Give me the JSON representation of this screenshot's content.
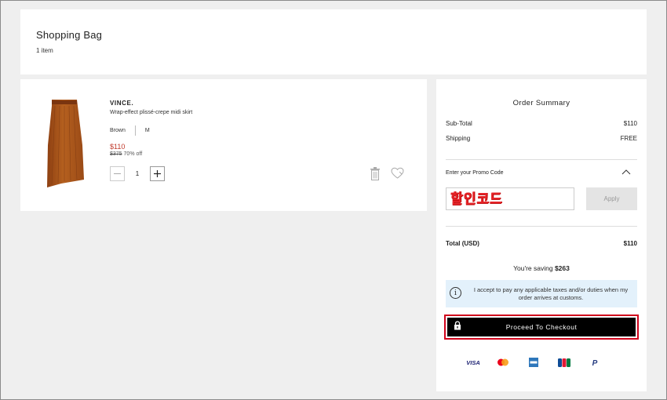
{
  "header": {
    "title": "Shopping Bag",
    "count": "1 item"
  },
  "item": {
    "brand": "VINCE.",
    "description": "Wrap-effect plissé-crepe midi skirt",
    "color": "Brown",
    "size": "M",
    "price": "$110",
    "original_price": "$375",
    "discount": "70% off",
    "quantity": "1",
    "image_icon": "skirt-thumbnail",
    "colors": {
      "skirt": "#b0561c",
      "price": "#c0392b"
    }
  },
  "summary": {
    "title": "Order Summary",
    "subtotal_label": "Sub-Total",
    "subtotal_value": "$110",
    "shipping_label": "Shipping",
    "shipping_value": "FREE",
    "promo_label": "Enter your Promo Code",
    "promo_value": "할인코드",
    "apply_label": "Apply",
    "total_label": "Total (USD)",
    "total_value": "$110",
    "saving_prefix": "You're saving",
    "saving_amount": "$263",
    "info_text": "I accept to pay any applicable taxes and/or duties when my order arrives at customs.",
    "checkout_label": "Proceed To Checkout",
    "checkout_highlight": "#d0021b"
  },
  "payments": [
    "VISA",
    "Mastercard",
    "Amex",
    "JCB",
    "PayPal"
  ]
}
